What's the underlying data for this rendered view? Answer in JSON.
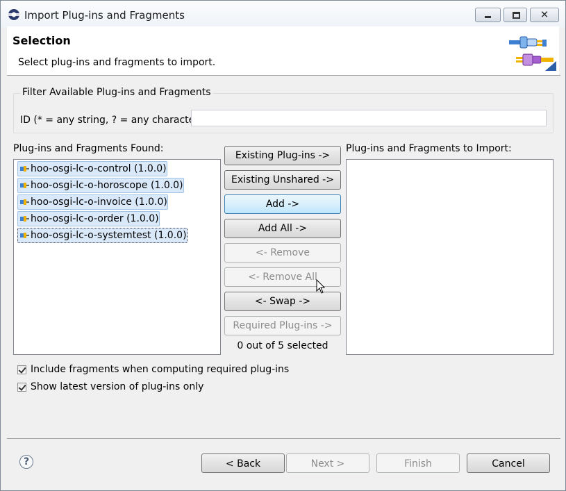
{
  "window": {
    "title": "Import Plug-ins and Fragments",
    "controls": {
      "minimize": "minimize-icon",
      "maximize": "maximize-icon",
      "close": "close-icon",
      "close_glyph": "✕"
    }
  },
  "banner": {
    "title": "Selection",
    "description": "Select plug-ins and fragments to import."
  },
  "filter": {
    "group_label": "Filter Available Plug-ins and Fragments",
    "id_label": "ID (* = any string, ? = any character):",
    "id_value": ""
  },
  "found": {
    "label": "Plug-ins and Fragments Found:",
    "items": [
      "hoo-osgi-lc-o-control (1.0.0)",
      "hoo-osgi-lc-o-horoscope (1.0.0)",
      "hoo-osgi-lc-o-invoice (1.0.0)",
      "hoo-osgi-lc-o-order (1.0.0)",
      "hoo-osgi-lc-o-systemtest (1.0.0)"
    ]
  },
  "to_import": {
    "label": "Plug-ins and Fragments to Import:",
    "items": []
  },
  "actions": {
    "existing_plugins": "Existing Plug-ins ->",
    "existing_unshared": "Existing Unshared ->",
    "add": "Add ->",
    "add_all": "Add All ->",
    "remove": "<- Remove",
    "remove_all": "<- Remove All",
    "swap": "<- Swap ->",
    "required_plugins": "Required Plug-ins ->"
  },
  "selection_status": "0 out of 5 selected",
  "options": {
    "include_fragments": {
      "label": "Include fragments when computing required plug-ins",
      "checked": true
    },
    "latest_only": {
      "label": "Show latest version of plug-ins only",
      "checked": true
    }
  },
  "footer": {
    "help": "?",
    "back": "< Back",
    "next": "Next >",
    "finish": "Finish",
    "cancel": "Cancel"
  },
  "colors": {
    "selection_bg": "#d9e9f9",
    "selection_border": "#9fc3e7",
    "hover_button": "#bee6fd"
  }
}
